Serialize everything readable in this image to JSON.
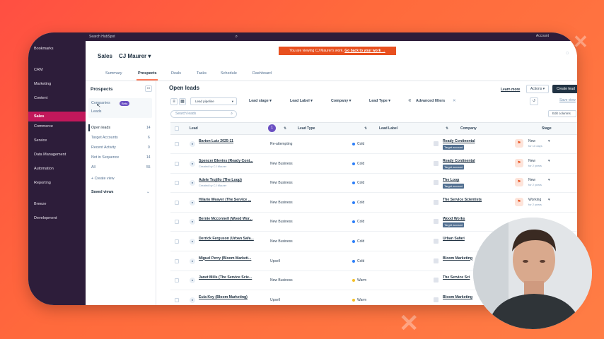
{
  "app": {
    "search_placeholder": "Search HubSpot",
    "topright": "Account"
  },
  "nav": {
    "items": [
      "Bookmarks",
      "CRM",
      "Marketing",
      "Content",
      "Sales",
      "Commerce",
      "Service",
      "Data Management",
      "Automation",
      "Reporting",
      "Breeze",
      "Development"
    ],
    "active": "Sales"
  },
  "banner": {
    "text": "You are viewing CJ Maurer's work.",
    "link": "Go back to your work →"
  },
  "header": {
    "workspace": "Sales",
    "user": "CJ Maurer ▾",
    "tabs": [
      "Summary",
      "Prospects",
      "Deals",
      "Tasks",
      "Schedule",
      "Dashboard"
    ],
    "active_tab": "Prospects"
  },
  "left_panel": {
    "title": "Prospects",
    "companies": "Companies",
    "beta": "Beta",
    "leads": "Leads",
    "views": [
      {
        "label": "Open leads",
        "count": "14"
      },
      {
        "label": "Target Accounts",
        "count": "6"
      },
      {
        "label": "Recent Activity",
        "count": "0"
      },
      {
        "label": "Not in Sequence",
        "count": "14"
      },
      {
        "label": "All",
        "count": "55"
      }
    ],
    "create_view": "+ Create view",
    "saved_views": "Saved views"
  },
  "content": {
    "title": "Open leads",
    "learn_more": "Learn more",
    "actions": "Actions ▾",
    "create_lead": "Create lead",
    "pipeline": "Lead pipeline",
    "filters": [
      "Lead stage ▾",
      "Lead Label ▾",
      "Company ▾",
      "Lead Type ▾"
    ],
    "advanced": "Advanced filters",
    "search_placeholder": "Search leads",
    "save_view": "Save view",
    "edit_columns": "Edit columns",
    "badge_count": "1"
  },
  "table": {
    "headers": [
      "Lead",
      "Lead Type",
      "Lead Label",
      "Company",
      "Stage"
    ],
    "rows": [
      {
        "name": "Barton Lutz 2025-11",
        "owner": "",
        "type": "Re-attempting",
        "label": "Cold",
        "company": "Ready Continental",
        "target": true,
        "stage": "New",
        "sub": "for 10 days"
      },
      {
        "name": "Spencer Blevins (Ready Cont...",
        "owner": "Created by CJ Maurer",
        "type": "New Business",
        "label": "Cold",
        "company": "Ready Continental",
        "target": true,
        "stage": "New",
        "sub": "for 2 years"
      },
      {
        "name": "Adele Trujillo (The Loop)",
        "owner": "Created by CJ Maurer",
        "type": "New Business",
        "label": "Cold",
        "company": "The Loop",
        "target": true,
        "stage": "New",
        "sub": "for 2 years"
      },
      {
        "name": "Hilario Weaver (The Service ...",
        "owner": "",
        "type": "New Business",
        "label": "Cold",
        "company": "The Service Scientists",
        "target": false,
        "stage": "Working",
        "sub": "for 2 years"
      },
      {
        "name": "Bernie Mcconnell (Wood Wor...",
        "owner": "",
        "type": "New Business",
        "label": "Cold",
        "company": "Wood Works",
        "target": true,
        "stage": "",
        "sub": ""
      },
      {
        "name": "Derrick Ferguson (Urban Safa...",
        "owner": "",
        "type": "New Business",
        "label": "Cold",
        "company": "Urban Safari",
        "target": false,
        "stage": "",
        "sub": ""
      },
      {
        "name": "Miguel Perry (Bloom Marketi...",
        "owner": "",
        "type": "Upsell",
        "label": "Cold",
        "company": "Bloom Marketing",
        "target": false,
        "stage": "",
        "sub": ""
      },
      {
        "name": "Janet Mills (The Service Scie...",
        "owner": "",
        "type": "New Business",
        "label": "Warm",
        "company": "The Service Sci",
        "target": false,
        "stage": "",
        "sub": ""
      },
      {
        "name": "Eula Key (Bloom Marketing)",
        "owner": "",
        "type": "Upsell",
        "label": "Warm",
        "company": "Bloom Marketing",
        "target": false,
        "stage": "",
        "sub": ""
      }
    ],
    "target_label": "Target account",
    "colors": {
      "cold": "#2d7ff9",
      "warm": "#f5c026"
    }
  }
}
